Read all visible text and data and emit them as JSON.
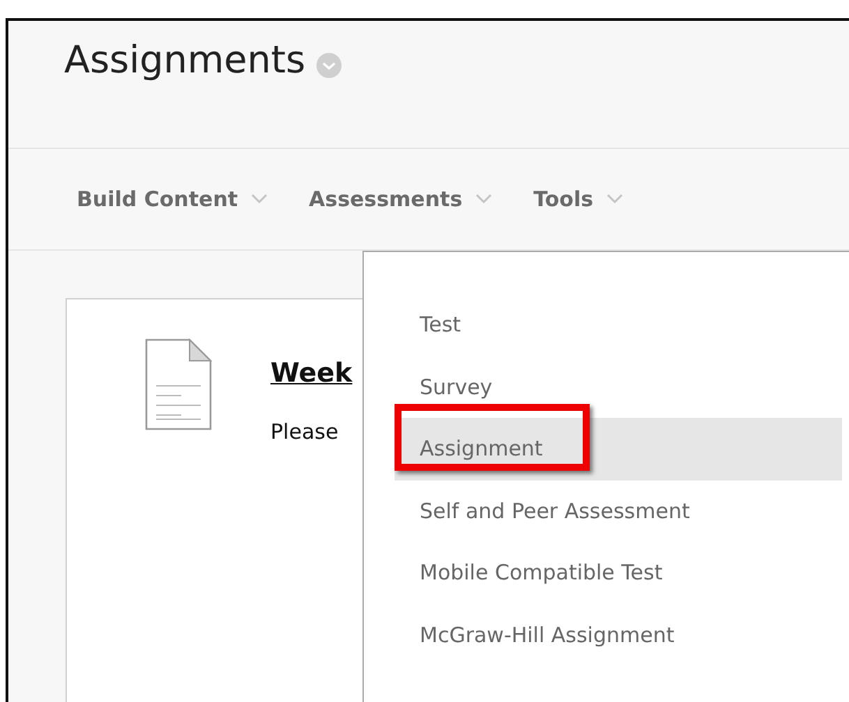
{
  "page_title": "Assignments",
  "nav": [
    {
      "label": "Build Content"
    },
    {
      "label": "Assessments"
    },
    {
      "label": "Tools"
    }
  ],
  "content_item": {
    "title": "Week",
    "text": "Please"
  },
  "menu_items": [
    {
      "label": "Test",
      "highlighted": false,
      "callout": false
    },
    {
      "label": "Survey",
      "highlighted": false,
      "callout": false
    },
    {
      "label": "Assignment",
      "highlighted": true,
      "callout": true
    },
    {
      "label": "Self and Peer Assessment",
      "highlighted": false,
      "callout": false
    },
    {
      "label": "Mobile Compatible Test",
      "highlighted": false,
      "callout": false
    },
    {
      "label": "McGraw-Hill Assignment",
      "highlighted": false,
      "callout": false
    }
  ]
}
